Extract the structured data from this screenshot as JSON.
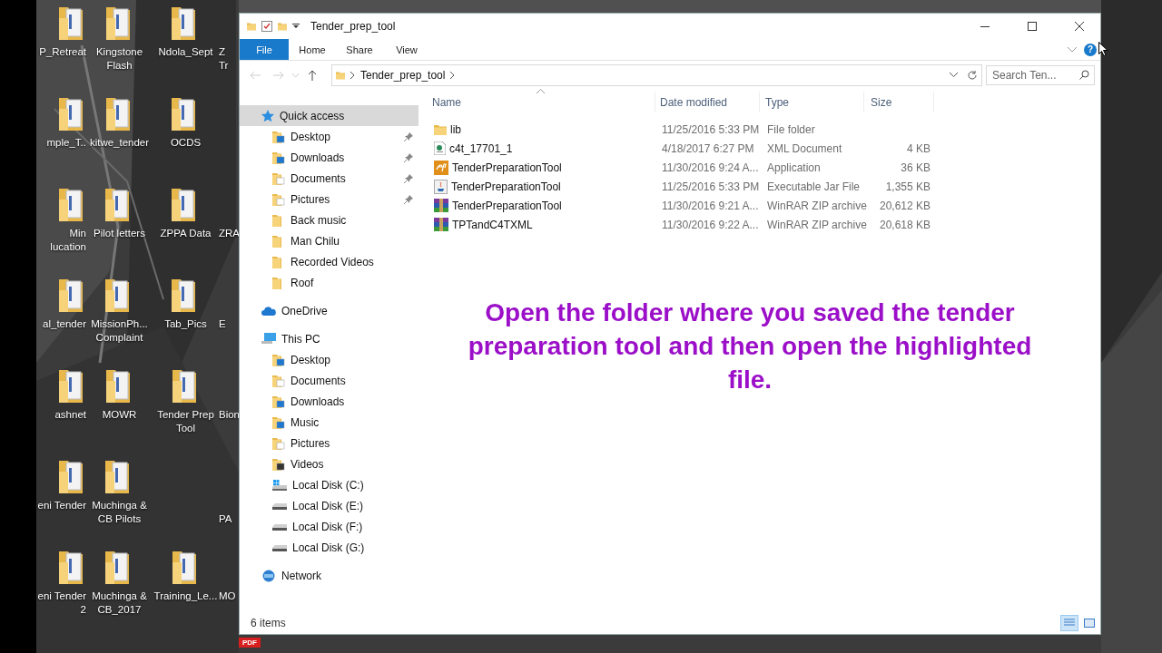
{
  "desktop": {
    "columns": [
      {
        "icons": [
          {
            "label": "P_Retreat"
          },
          {
            "label": "mple_T.."
          },
          {
            "label": "Min\nlucation"
          },
          {
            "label": "al_tender"
          },
          {
            "label": "ashnet"
          },
          {
            "label": "eni Tender"
          },
          {
            "label": "eni Tender\n2"
          }
        ]
      },
      {
        "icons": [
          {
            "label": "Kingstone\nFlash"
          },
          {
            "label": "kitwe_tender"
          },
          {
            "label": "Pilot letters"
          },
          {
            "label": "MissionPh...\nComplaint"
          },
          {
            "label": "MOWR"
          },
          {
            "label": "Muchinga &\nCB Pilots"
          },
          {
            "label": "Muchinga &\nCB_2017"
          }
        ]
      },
      {
        "icons": [
          {
            "label": "Ndola_Sept"
          },
          {
            "label": "OCDS"
          },
          {
            "label": "ZPPA Data"
          },
          {
            "label": "Tab_Pics"
          },
          {
            "label": "Tender Prep\nTool"
          },
          {
            "kind": "gap"
          },
          {
            "label": "Training_Le..."
          }
        ]
      },
      {
        "icons": [
          {
            "label": "Z\nTr"
          },
          {
            "kind": "gap"
          },
          {
            "label": "ZRA"
          },
          {
            "label": "E"
          },
          {
            "label": "Bion"
          },
          {
            "label": "\nPA"
          },
          {
            "label": "MO"
          }
        ]
      }
    ],
    "taskbar_badge": "PDF"
  },
  "window": {
    "title": "Tender_prep_tool"
  },
  "ribbon": {
    "tabs": [
      {
        "label": "File",
        "selected": true
      },
      {
        "label": "Home",
        "selected": false
      },
      {
        "label": "Share",
        "selected": false
      },
      {
        "label": "View",
        "selected": false
      }
    ],
    "help": "?"
  },
  "address": {
    "path": [
      "Tender_prep_tool"
    ]
  },
  "search": {
    "placeholder": "Search Ten..."
  },
  "nav": [
    {
      "label": "Quick access",
      "kind": "star",
      "selected": true,
      "children": [
        {
          "label": "Desktop",
          "kind": "desktop",
          "pinned": true
        },
        {
          "label": "Downloads",
          "kind": "downloads",
          "pinned": true
        },
        {
          "label": "Documents",
          "kind": "documents",
          "pinned": true
        },
        {
          "label": "Pictures",
          "kind": "pictures",
          "pinned": true
        },
        {
          "label": "Back music",
          "kind": "folder",
          "pinned": false
        },
        {
          "label": "Man Chilu",
          "kind": "folder",
          "pinned": false
        },
        {
          "label": "Recorded Videos",
          "kind": "folder",
          "pinned": false
        },
        {
          "label": "Roof",
          "kind": "folder",
          "pinned": false
        }
      ]
    },
    {
      "label": "OneDrive",
      "kind": "cloud",
      "selected": false
    },
    {
      "label": "This PC",
      "kind": "pc",
      "selected": false,
      "children": [
        {
          "label": "Desktop",
          "kind": "desktop"
        },
        {
          "label": "Documents",
          "kind": "documents"
        },
        {
          "label": "Downloads",
          "kind": "downloads"
        },
        {
          "label": "Music",
          "kind": "music"
        },
        {
          "label": "Pictures",
          "kind": "pictures"
        },
        {
          "label": "Videos",
          "kind": "videos"
        },
        {
          "label": "Local Disk (C:)",
          "kind": "drive-c"
        },
        {
          "label": "Local Disk (E:)",
          "kind": "drive"
        },
        {
          "label": "Local Disk (F:)",
          "kind": "drive"
        },
        {
          "label": "Local Disk (G:)",
          "kind": "drive"
        }
      ]
    },
    {
      "label": "Network",
      "kind": "network",
      "selected": false
    }
  ],
  "columns": [
    "Name",
    "Date modified",
    "Type",
    "Size"
  ],
  "files": [
    {
      "name": "lib",
      "kind": "folder",
      "date": "11/25/2016 5:33 PM",
      "type": "File folder"
    },
    {
      "name": "c4t_17701_1",
      "kind": "xml",
      "date": "4/18/2017 6:27 PM",
      "type": "XML Document",
      "size": "4 KB"
    },
    {
      "name": "TenderPreparationTool",
      "kind": "app",
      "date": "11/30/2016 9:24 A...",
      "type": "Application",
      "size": "36 KB"
    },
    {
      "name": "TenderPreparationTool",
      "kind": "jar",
      "date": "11/25/2016 5:33 PM",
      "type": "Executable Jar File",
      "size": "1,355 KB"
    },
    {
      "name": "TenderPreparationTool",
      "kind": "rar",
      "date": "11/30/2016 9:21 A...",
      "type": "WinRAR ZIP archive",
      "size": "20,612 KB"
    },
    {
      "name": "TPTandC4TXML",
      "kind": "rar",
      "date": "11/30/2016 9:22 A...",
      "type": "WinRAR ZIP archive",
      "size": "20,618 KB"
    }
  ],
  "caption": "Open the folder where you saved the tender preparation tool and then open the highlighted file.",
  "status": {
    "count": "6 items",
    "views": [
      {
        "kind": "details",
        "selected": true
      },
      {
        "kind": "large",
        "selected": false
      }
    ]
  }
}
